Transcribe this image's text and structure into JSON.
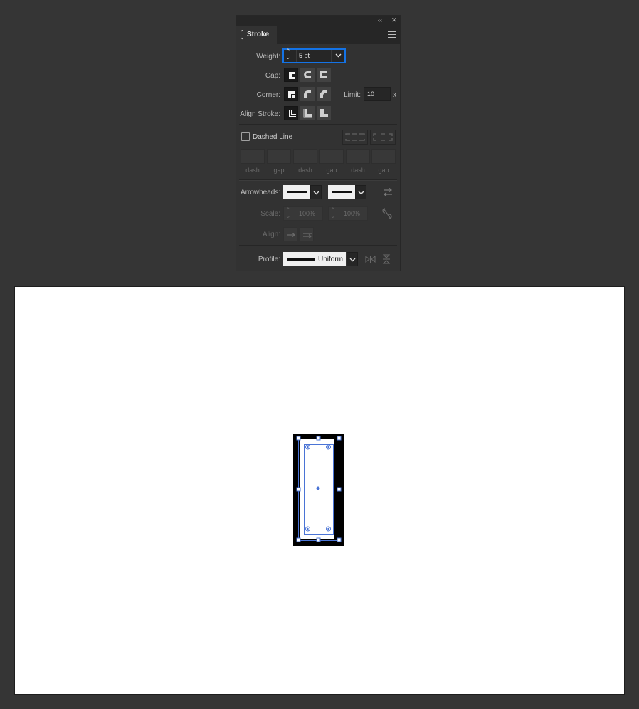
{
  "panel": {
    "tab_label": "Stroke",
    "collapse_glyph": "‹‹",
    "close_glyph": "✕",
    "weight": {
      "label": "Weight:",
      "value": "5 pt"
    },
    "cap": {
      "label": "Cap:"
    },
    "corner": {
      "label": "Corner:",
      "limit_label": "Limit:",
      "limit_value": "10",
      "limit_unit": "x"
    },
    "align_stroke": {
      "label": "Align Stroke:"
    },
    "dashed_line": {
      "label": "Dashed Line",
      "checked": false
    },
    "dash_gap_labels": [
      "dash",
      "gap",
      "dash",
      "gap",
      "dash",
      "gap"
    ],
    "arrowheads": {
      "label": "Arrowheads:"
    },
    "scale": {
      "label": "Scale:",
      "start": "100%",
      "end": "100%"
    },
    "align": {
      "label": "Align:"
    },
    "profile": {
      "label": "Profile:",
      "value": "Uniform"
    }
  },
  "colors": {
    "accent": "#1473e6",
    "selection": "#4a74d6",
    "panel_bg": "#323232",
    "app_bg": "#353535"
  }
}
